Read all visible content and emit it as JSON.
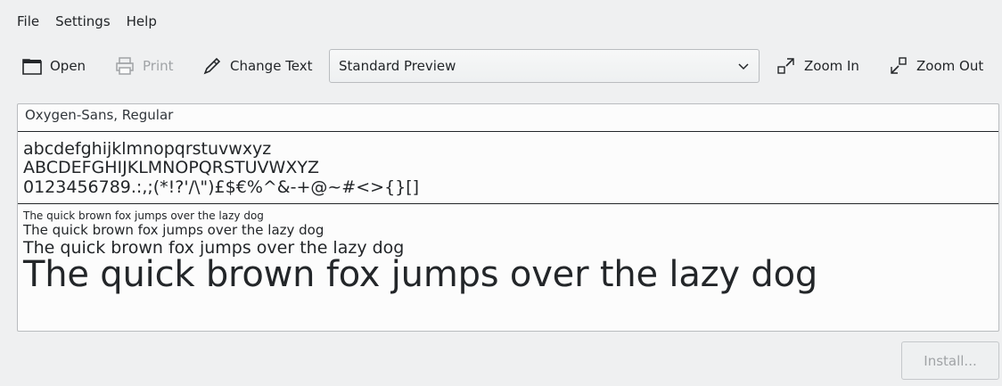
{
  "menubar": {
    "items": [
      "File",
      "Settings",
      "Help"
    ]
  },
  "toolbar": {
    "open_label": "Open",
    "print_label": "Print",
    "change_text_label": "Change Text",
    "preview_select_value": "Standard Preview",
    "zoom_in_label": "Zoom In",
    "zoom_out_label": "Zoom Out"
  },
  "preview": {
    "font_name": "Oxygen-Sans, Regular",
    "lowercase": "abcdefghijklmnopqrstuvwxyz",
    "uppercase": "ABCDEFGHIJKLMNOPQRSTUVWXYZ",
    "digits_symbols": "0123456789.:,;(*!?'/\\\")£$€%^&-+@~#<>{}[]",
    "samples": [
      "The quick brown fox jumps over the lazy dog",
      "The quick brown fox jumps over the lazy dog",
      "The quick brown fox jumps over the lazy dog",
      "The quick brown fox jumps over the lazy dog"
    ]
  },
  "footer": {
    "install_label": "Install..."
  },
  "icons": {
    "open": "folder-icon",
    "print": "printer-icon",
    "change_text": "pencil-icon",
    "select": "chevron-down-icon",
    "zoom_in": "zoom-in-icon",
    "zoom_out": "zoom-out-icon"
  }
}
